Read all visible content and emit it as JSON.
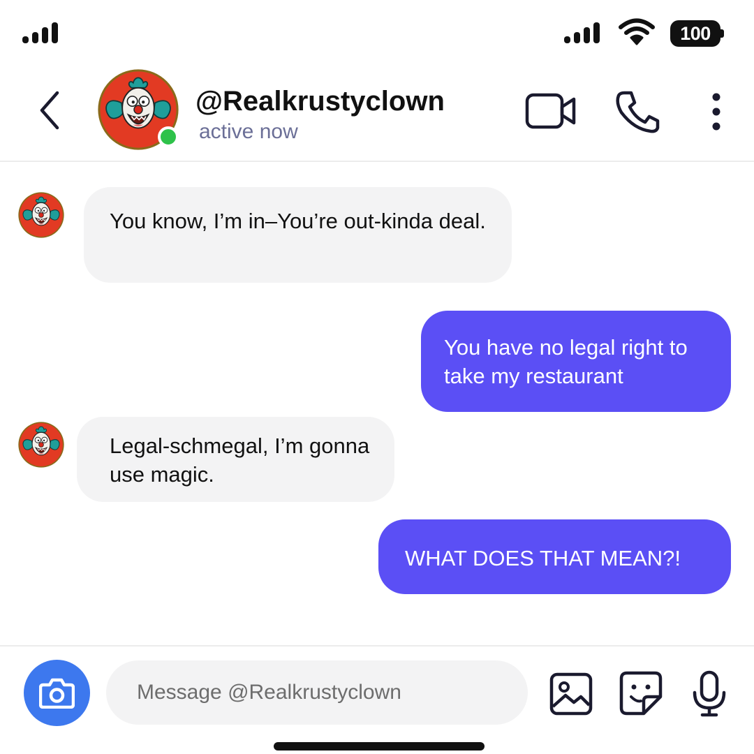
{
  "status_bar": {
    "battery": "100"
  },
  "header": {
    "username": "@Realkrustyclown",
    "presence": "active now",
    "online_color": "#2ec24a"
  },
  "messages": [
    {
      "direction": "incoming",
      "text": "You know, I’m in–You’re out-kinda deal."
    },
    {
      "direction": "outgoing",
      "text": "You have no legal right to take my restaurant"
    },
    {
      "direction": "incoming",
      "text": "Legal-schmegal, I’m gonna use magic."
    },
    {
      "direction": "outgoing",
      "text": "WHAT DOES THAT MEAN?!"
    }
  ],
  "composer": {
    "placeholder": "Message @Realkrustyclown",
    "value": ""
  },
  "icons": [
    "signal-icon",
    "wifi-icon",
    "battery-icon",
    "back-chevron-icon",
    "video-camera-icon",
    "phone-icon",
    "more-vertical-icon",
    "camera-icon",
    "image-icon",
    "sticker-icon",
    "microphone-icon"
  ],
  "colors": {
    "outgoing_bubble": "#5b4ff5",
    "incoming_bubble": "#f3f3f4",
    "camera_button": "#3d78ee",
    "avatar_bg": "#e23a23"
  }
}
